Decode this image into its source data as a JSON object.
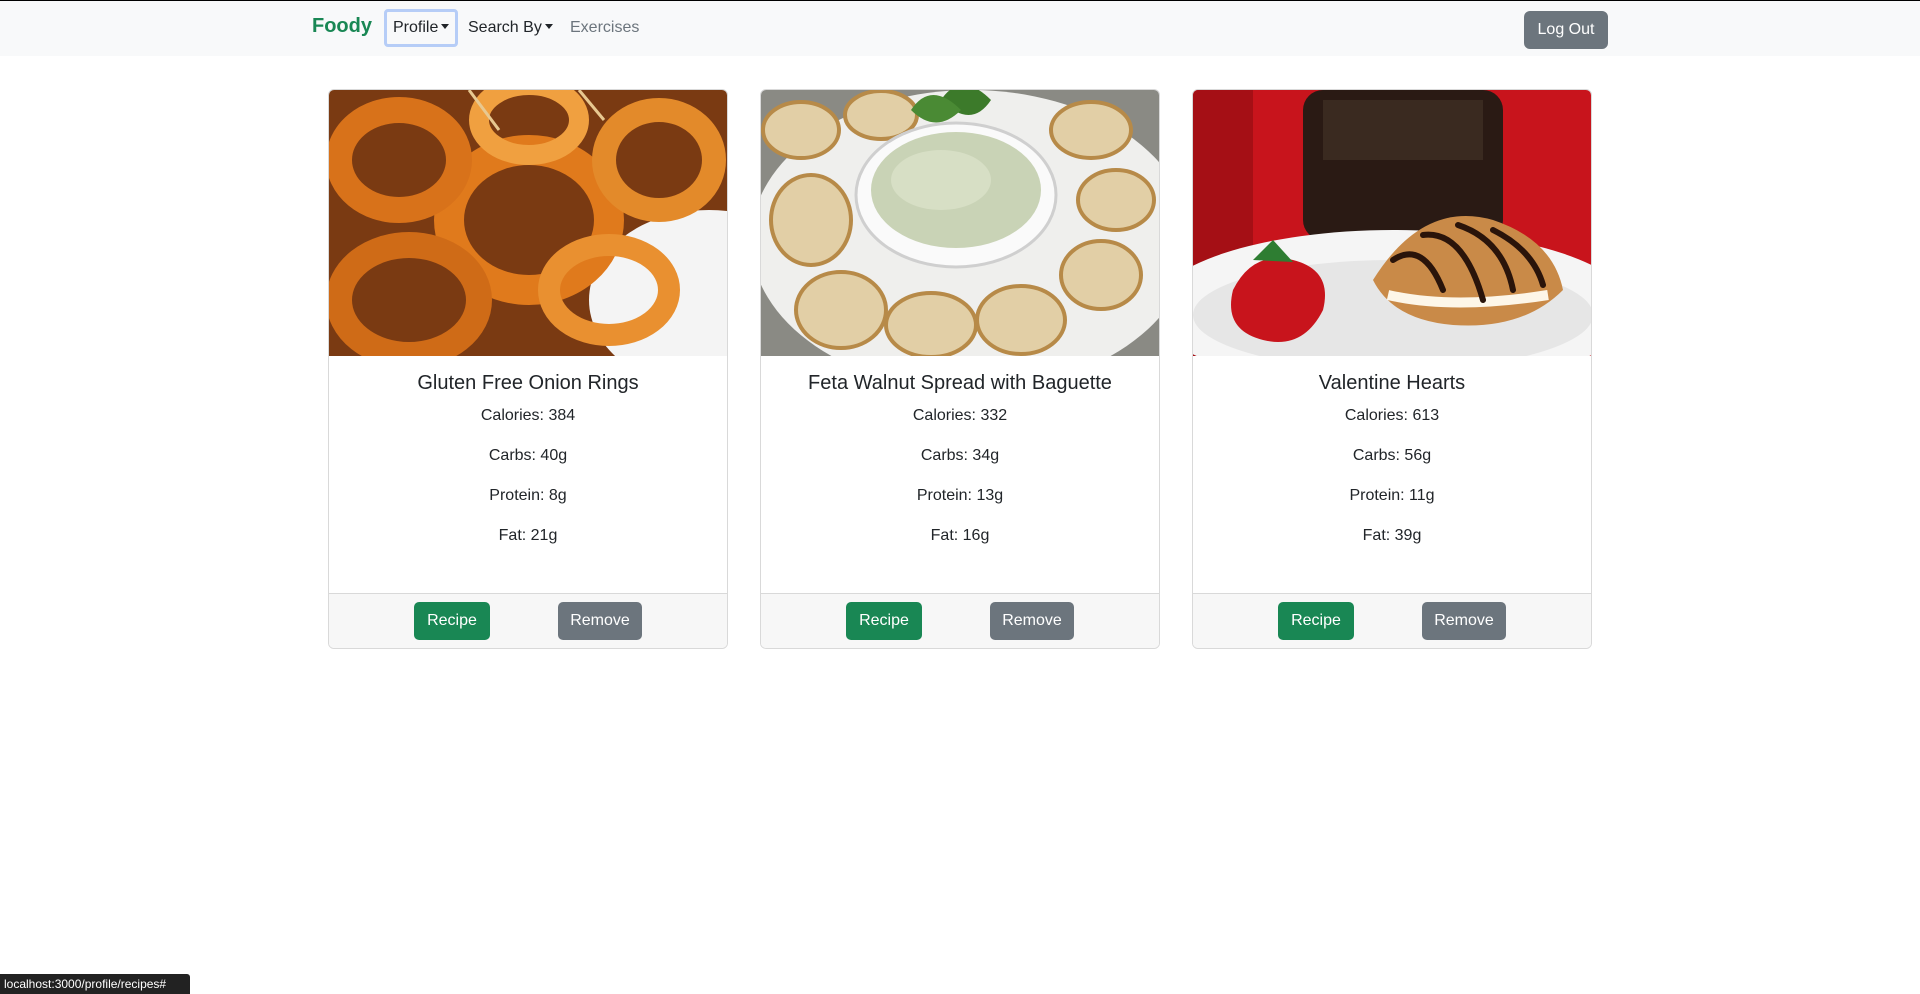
{
  "nav": {
    "brand": "Foody",
    "profile": "Profile",
    "search_by": "Search By",
    "exercises": "Exercises",
    "logout": "Log Out",
    "brand_color": "#198754"
  },
  "recipes": [
    {
      "title": "Gluten Free Onion Rings",
      "calories": "Calories: 384",
      "carbs": "Carbs: 40g",
      "protein": "Protein: 8g",
      "fat": "Fat: 21g",
      "recipe_label": "Recipe",
      "remove_label": "Remove"
    },
    {
      "title": "Feta Walnut Spread with Baguette",
      "calories": "Calories: 332",
      "carbs": "Carbs: 34g",
      "protein": "Protein: 13g",
      "fat": "Fat: 16g",
      "recipe_label": "Recipe",
      "remove_label": "Remove"
    },
    {
      "title": "Valentine Hearts",
      "calories": "Calories: 613",
      "carbs": "Carbs: 56g",
      "protein": "Protein: 11g",
      "fat": "Fat: 39g",
      "recipe_label": "Recipe",
      "remove_label": "Remove"
    }
  ],
  "status_bar": "localhost:3000/profile/recipes#",
  "colors": {
    "primary_button": "#198754",
    "secondary_button": "#6c757d"
  }
}
